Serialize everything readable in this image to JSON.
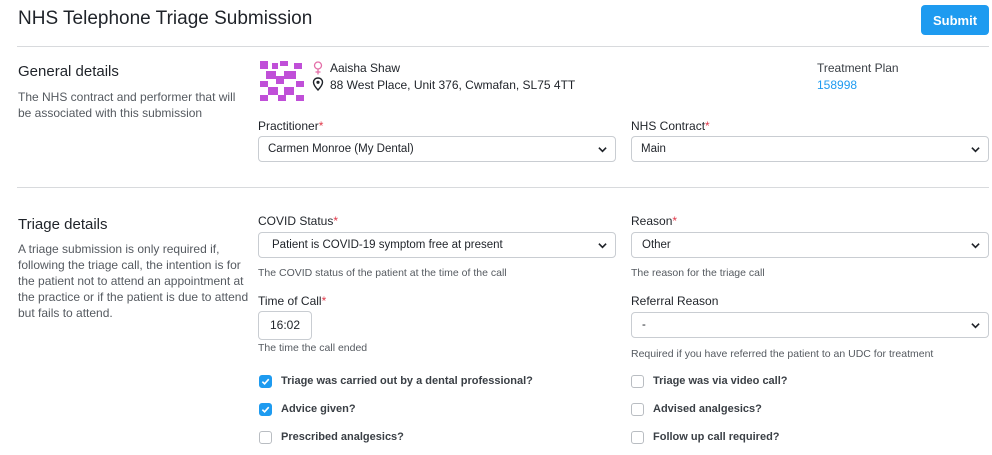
{
  "header": {
    "title": "NHS Telephone Triage Submission",
    "submit_label": "Submit"
  },
  "general": {
    "title": "General details",
    "description": "The NHS contract and performer that will be associated with this submission",
    "patient": {
      "name": "Aaisha Shaw",
      "address": "88 West Place, Unit 376, Cwmafan, SL75 4TT",
      "gender_icon": "female-icon",
      "location_icon": "map-pin-icon"
    },
    "treatment_plan": {
      "label": "Treatment Plan",
      "value": "158998"
    },
    "practitioner": {
      "label": "Practitioner",
      "value": "Carmen Monroe (My Dental)"
    },
    "nhs_contract": {
      "label": "NHS Contract",
      "value": "Main"
    }
  },
  "triage": {
    "title": "Triage details",
    "description": "A triage submission is only required if, following the triage call, the intention is for the patient not to attend an appointment at the practice or if the patient is due to attend but fails to attend.",
    "covid_status": {
      "label": "COVID Status",
      "value": "Patient is COVID-19 symptom free at present",
      "help": "The COVID status of the patient at the time of the call"
    },
    "reason": {
      "label": "Reason",
      "value": "Other",
      "help": "The reason for the triage call"
    },
    "time_of_call": {
      "label": "Time of Call",
      "value": "16:02",
      "help": "The time the call ended"
    },
    "referral_reason": {
      "label": "Referral Reason",
      "value": "-",
      "help": "Required if you have referred the patient to an UDC for treatment"
    },
    "checkboxes_left": [
      {
        "label": "Triage was carried out by a dental professional?",
        "checked": true
      },
      {
        "label": "Advice given?",
        "checked": true
      },
      {
        "label": "Prescribed analgesics?",
        "checked": false
      }
    ],
    "checkboxes_right": [
      {
        "label": "Triage was via video call?",
        "checked": false
      },
      {
        "label": "Advised analgesics?",
        "checked": false
      },
      {
        "label": "Follow up call required?",
        "checked": false
      }
    ]
  },
  "colors": {
    "accent": "#1e9bf0",
    "required": "#e0394a",
    "avatar": "#c04fd8"
  }
}
